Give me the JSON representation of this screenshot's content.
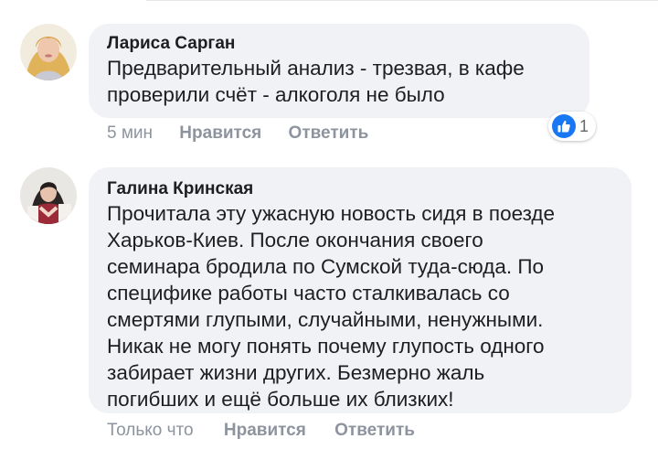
{
  "comments": [
    {
      "author": "Лариса Сарган",
      "text_lines": [
        "Предварительный анализ - трезвая, в кафе",
        "проверили счёт - алкоголя не было"
      ],
      "time": "5 мин",
      "like_label": "Нравится",
      "reply_label": "Ответить",
      "reaction_count": "1",
      "reaction_icon": "thumbs-up-icon"
    },
    {
      "author": "Галина Кринская",
      "text_lines": [
        "Прочитала эту ужасную новость сидя в поезде",
        "Харьков-Киев. После окончания своего",
        "семинара бродила по Сумской туда-сюда. По",
        "специфике работы часто сталкивалась со",
        "смертями глупыми, случайными, ненужными.",
        "Никак не могу понять почему глупость одного",
        "забирает жизни других. Безмерно жаль",
        "погибших и ещё больше их близких!"
      ],
      "time": "Только что",
      "like_label": "Нравится",
      "reply_label": "Ответить"
    }
  ],
  "colors": {
    "bubble": "#f0f2f5",
    "meta": "#8d949e",
    "like_blue": "#1877f2"
  }
}
